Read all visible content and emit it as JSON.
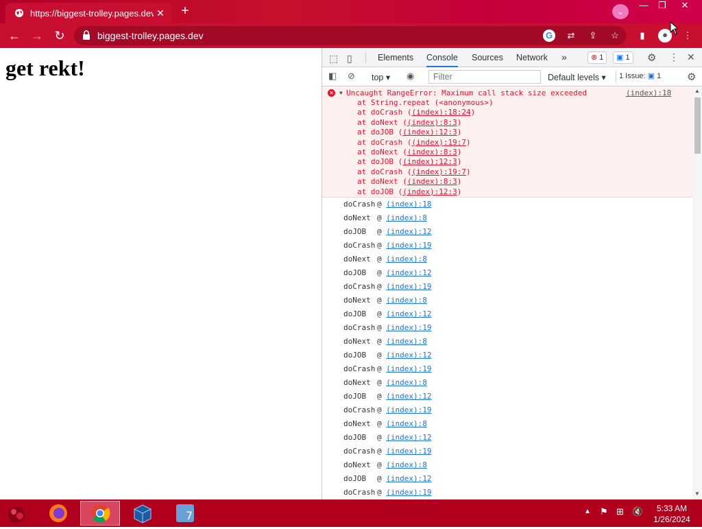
{
  "browser": {
    "tab_title": "https://biggest-trolley.pages.dev",
    "address": "biggest-trolley.pages.dev"
  },
  "page": {
    "heading": "get rekt!"
  },
  "devtools": {
    "tabs": [
      "Elements",
      "Console",
      "Sources",
      "Network"
    ],
    "more": "»",
    "error_count": "1",
    "message_count": "1",
    "context": "top",
    "filter_placeholder": "Filter",
    "levels": "Default levels",
    "issues_label": "1 Issue:",
    "issues_count": "1"
  },
  "console": {
    "error": {
      "message": "Uncaught RangeError: Maximum call stack size exceeded",
      "source": "(index):18",
      "stack": [
        {
          "text": "at String.repeat (<anonymous>)",
          "link": ""
        },
        {
          "text": "at doCrash (",
          "link": "(index):18:24",
          "tail": ")"
        },
        {
          "text": "at doNext (",
          "link": "(index):8:3",
          "tail": ")"
        },
        {
          "text": "at doJOB (",
          "link": "(index):12:3",
          "tail": ")"
        },
        {
          "text": "at doCrash (",
          "link": "(index):19:7",
          "tail": ")"
        },
        {
          "text": "at doNext (",
          "link": "(index):8:3",
          "tail": ")"
        },
        {
          "text": "at doJOB (",
          "link": "(index):12:3",
          "tail": ")"
        },
        {
          "text": "at doCrash (",
          "link": "(index):19:7",
          "tail": ")"
        },
        {
          "text": "at doNext (",
          "link": "(index):8:3",
          "tail": ")"
        },
        {
          "text": "at doJOB (",
          "link": "(index):12:3",
          "tail": ")"
        }
      ]
    },
    "rows": [
      {
        "fn": "doCrash",
        "link": "(index):18"
      },
      {
        "fn": "doNext",
        "link": "(index):8"
      },
      {
        "fn": "doJOB",
        "link": "(index):12"
      },
      {
        "fn": "doCrash",
        "link": "(index):19"
      },
      {
        "fn": "doNext",
        "link": "(index):8"
      },
      {
        "fn": "doJOB",
        "link": "(index):12"
      },
      {
        "fn": "doCrash",
        "link": "(index):19"
      },
      {
        "fn": "doNext",
        "link": "(index):8"
      },
      {
        "fn": "doJOB",
        "link": "(index):12"
      },
      {
        "fn": "doCrash",
        "link": "(index):19"
      },
      {
        "fn": "doNext",
        "link": "(index):8"
      },
      {
        "fn": "doJOB",
        "link": "(index):12"
      },
      {
        "fn": "doCrash",
        "link": "(index):19"
      },
      {
        "fn": "doNext",
        "link": "(index):8"
      },
      {
        "fn": "doJOB",
        "link": "(index):12"
      },
      {
        "fn": "doCrash",
        "link": "(index):19"
      },
      {
        "fn": "doNext",
        "link": "(index):8"
      },
      {
        "fn": "doJOB",
        "link": "(index):12"
      },
      {
        "fn": "doCrash",
        "link": "(index):19"
      },
      {
        "fn": "doNext",
        "link": "(index):8"
      },
      {
        "fn": "doJOB",
        "link": "(index):12"
      },
      {
        "fn": "doCrash",
        "link": "(index):19"
      }
    ]
  },
  "taskbar": {
    "time": "5:33 AM",
    "date": "1/26/2024",
    "apps": [
      "firefox-icon",
      "chrome-icon",
      "virtualbox-icon",
      "win7-icon"
    ]
  },
  "colors": {
    "browser_frame": "#c90f31",
    "error_red": "#e8112d",
    "link_blue": "#1a73e8"
  }
}
